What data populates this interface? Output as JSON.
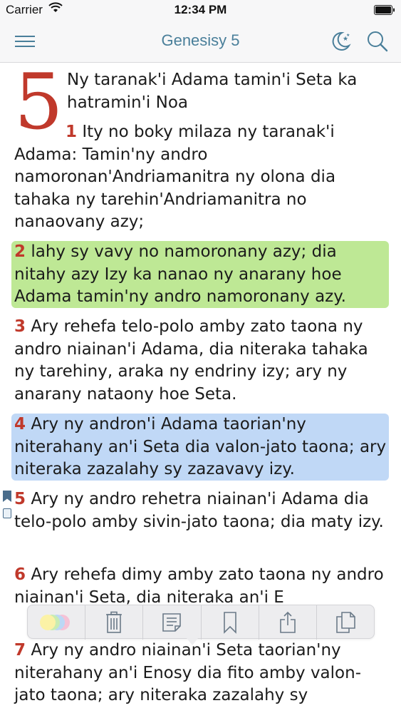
{
  "status_bar": {
    "carrier": "Carrier",
    "time": "12:34 PM"
  },
  "nav": {
    "title": "Genesisy 5",
    "menu_icon": "hamburger-menu-icon",
    "night_icon": "moon-stars-icon",
    "search_icon": "search-icon",
    "title_color": "#4a7f9a"
  },
  "chapter": {
    "number": "5",
    "heading": "Ny taranak'i Adama tamin'i Seta ka hatramin'i Noa",
    "dropcap_color": "#c0392b"
  },
  "verses": [
    {
      "num": "1",
      "text": "Ity no boky milaza ny taranak'i Adama: Tamin'ny andro namoronan'Andriamanitra ny olona dia tahaka ny tarehin'Andriamanitra no nanaovany azy;",
      "highlight": "none"
    },
    {
      "num": "2",
      "text": "lahy sy vavy no namoronany azy; dia nitahy azy Izy ka nanao ny anarany hoe Adama tamin'ny andro namoronany azy.",
      "highlight": "green"
    },
    {
      "num": "3",
      "text": "Ary rehefa telo-polo amby zato taona ny andro niainan'i Adama, dia niteraka tahaka ny tarehiny, araka ny endriny izy; ary ny anarany nataony hoe Seta.",
      "highlight": "none"
    },
    {
      "num": "4",
      "text": "Ary ny andron'i Adama taorian'ny niterahany an'i Seta dia valon-jato taona; ary niteraka zazalahy sy zazavavy izy.",
      "highlight": "blue"
    },
    {
      "num": "5",
      "text": "Ary ny andro rehetra niainan'i Adama dia telo-polo amby sivin-jato taona; dia maty izy.",
      "highlight": "none",
      "bookmarked": true
    },
    {
      "num": "6",
      "text": "Ary rehefa dimy amby zato taona ny andro niainan'i Seta, dia niteraka an'i E",
      "highlight": "none"
    },
    {
      "num": "7",
      "text": "Ary ny andro niainan'i Seta taorian'ny niterahany an'i Enosy dia fito amby valon-jato taona; ary niteraka zazalahy sy",
      "highlight": "none"
    }
  ],
  "highlight_colors": {
    "green": "#b7e58a",
    "blue": "#b9d4f5"
  },
  "toolbar": {
    "items": [
      {
        "name": "color-picker",
        "icon": "color-swatch-icon"
      },
      {
        "name": "delete",
        "icon": "trash-icon"
      },
      {
        "name": "note",
        "icon": "note-icon"
      },
      {
        "name": "bookmark",
        "icon": "bookmark-icon"
      },
      {
        "name": "share",
        "icon": "share-icon"
      },
      {
        "name": "copy",
        "icon": "copy-icon"
      }
    ]
  }
}
